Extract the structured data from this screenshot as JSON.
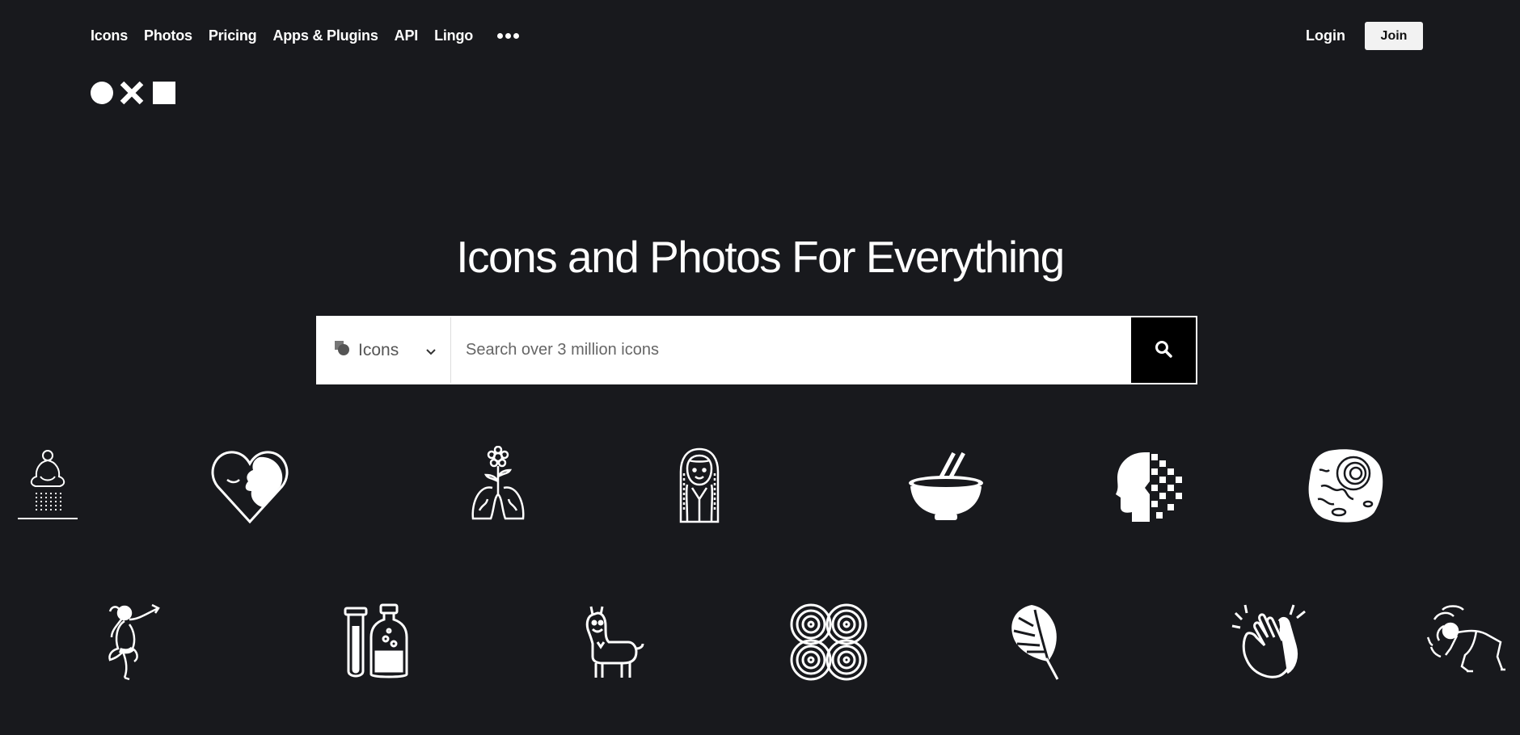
{
  "nav": {
    "links": [
      "Icons",
      "Photos",
      "Pricing",
      "Apps & Plugins",
      "API",
      "Lingo"
    ],
    "more_icon": "more-dots-icon",
    "login": "Login",
    "join": "Join"
  },
  "logo": {
    "icon": "noun-project-logo"
  },
  "hero": {
    "title": "Icons and Photos For Everything"
  },
  "search": {
    "type_label": "Icons",
    "placeholder": "Search over 3 million icons",
    "button_icon": "search-icon"
  },
  "icon_grid": {
    "row1": [
      "meditation-shower-icon",
      "heart-face-icon",
      "flower-lungs-icon",
      "woman-braids-icon",
      "bowl-chopsticks-icon",
      "pixel-head-icon",
      "fossil-stone-icon"
    ],
    "row2": [
      "dancing-woman-icon",
      "test-tube-bottle-icon",
      "llama-icon",
      "spiral-pattern-icon",
      "monstera-leaf-icon",
      "clapping-hands-icon",
      "stretching-person-icon"
    ]
  },
  "colors": {
    "background": "#18191d",
    "foreground": "#ffffff",
    "search_button": "#000000"
  }
}
